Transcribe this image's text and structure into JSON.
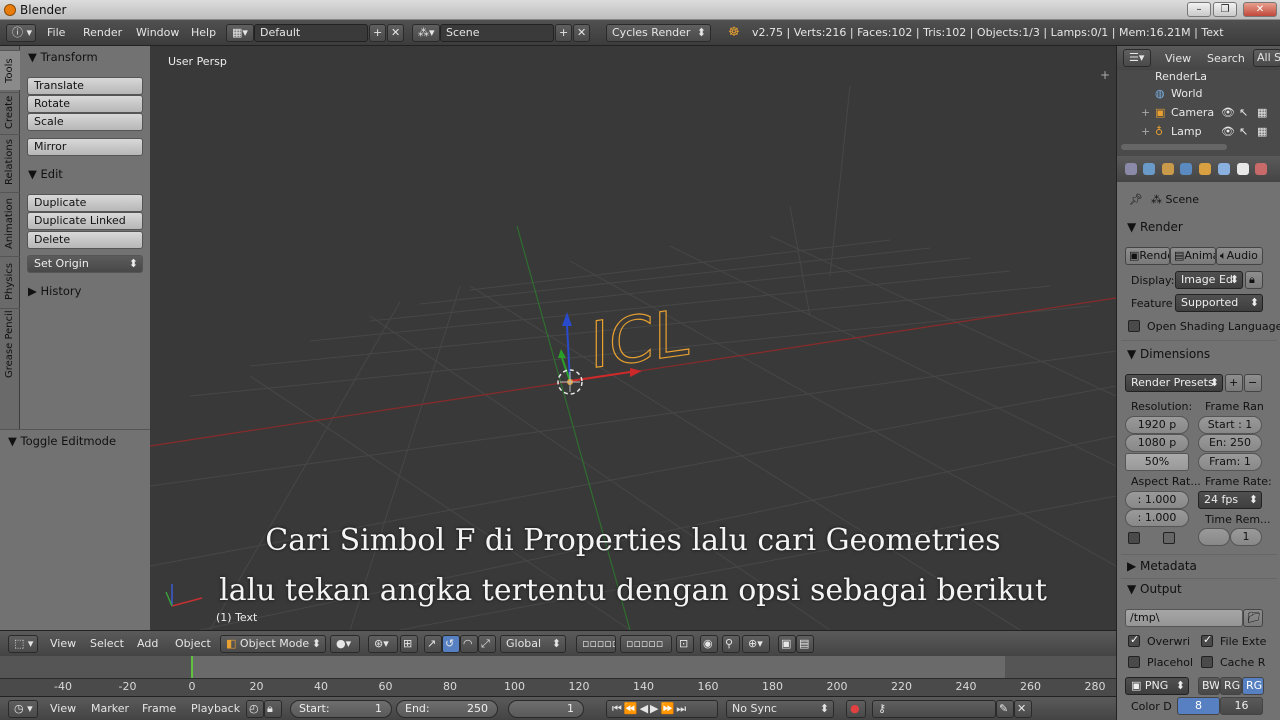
{
  "window": {
    "title": "Blender"
  },
  "info_header": {
    "menus": [
      "File",
      "Render",
      "Window",
      "Help"
    ],
    "layout": "Default",
    "scene": "Scene",
    "engine": "Cycles Render",
    "stats": "v2.75 | Verts:216 | Faces:102 | Tris:102 | Objects:1/3 | Lamps:0/1 | Mem:16.21M | Text"
  },
  "tool_tabs": [
    "Tools",
    "Create",
    "Relations",
    "Animation",
    "Physics",
    "Grease Pencil"
  ],
  "tool_shelf": {
    "transform_title": "Transform",
    "transform_buttons": [
      "Translate",
      "Rotate",
      "Scale"
    ],
    "mirror": "Mirror",
    "edit_title": "Edit",
    "edit_buttons": [
      "Duplicate",
      "Duplicate Linked",
      "Delete"
    ],
    "set_origin": "Set Origin",
    "history": "History",
    "toggle_editmode": "Toggle Editmode"
  },
  "viewport": {
    "label": "User Persp",
    "object_label": "(1) Text",
    "text_object": "ICL",
    "caption_line1": "Cari Simbol F di Properties lalu cari Geometries",
    "caption_line2": "lalu tekan angka tertentu dengan opsi sebagai berikut"
  },
  "viewport_header": {
    "menus": [
      "View",
      "Select",
      "Add",
      "Object"
    ],
    "mode": "Object Mode",
    "orientation": "Global"
  },
  "timeline": {
    "ticks": [
      "-40",
      "-20",
      "0",
      "20",
      "40",
      "60",
      "80",
      "100",
      "120",
      "140",
      "160",
      "180",
      "200",
      "220",
      "240",
      "260",
      "280"
    ],
    "menus": [
      "View",
      "Marker",
      "Frame",
      "Playback"
    ],
    "start_label": "Start:",
    "start_value": "1",
    "end_label": "End:",
    "end_value": "250",
    "current_frame": "1",
    "sync": "No Sync"
  },
  "outliner": {
    "menus": [
      "View",
      "Search"
    ],
    "filter": "All Sc",
    "items": [
      "RenderLa",
      "World",
      "Camera",
      "Lamp"
    ]
  },
  "properties": {
    "context": "Scene",
    "render_title": "Render",
    "render_buttons": [
      "Rende",
      "Anima",
      "Audio"
    ],
    "display_label": "Display:",
    "display_value": "Image Ed",
    "feature_label": "Feature",
    "feature_value": "Supported",
    "osl": "Open Shading Language",
    "dimensions_title": "Dimensions",
    "render_presets": "Render Presets",
    "resolution_label": "Resolution:",
    "res_x": "1920 p",
    "res_y": "1080 p",
    "res_pct": "50%",
    "frame_range_label": "Frame Ran",
    "frame_start": "Start : 1",
    "frame_end": "En: 250",
    "frame_step": "Fram: 1",
    "aspect_label": "Aspect Rat...",
    "aspect_x": ": 1.000",
    "aspect_y": ": 1.000",
    "frame_rate_label": "Frame Rate:",
    "frame_rate": "24 fps",
    "time_remap_label": "Time Rem...",
    "time_remap_value": "1",
    "metadata_title": "Metadata",
    "output_title": "Output",
    "output_path": "/tmp\\",
    "overwrite": "Overwri",
    "file_ext": "File Exte",
    "placeholders": "Placehol",
    "cache": "Cache R",
    "format": "PNG",
    "color_modes": [
      "BW",
      "RGB",
      "RGB"
    ],
    "color_depth_label": "Color D",
    "color_depth_values": [
      "8",
      "16"
    ]
  },
  "colors": {
    "accent_blue": "#5680c2",
    "text_orange": "#e8a030",
    "axis_red": "#b83030",
    "axis_green": "#3a9a3a"
  }
}
